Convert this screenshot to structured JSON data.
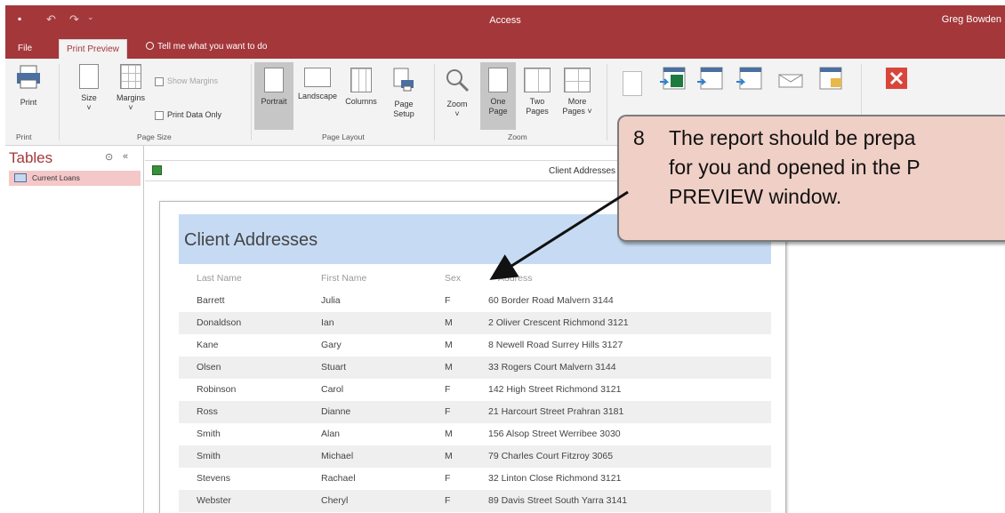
{
  "window": {
    "app_title": "Access",
    "user": "Greg Bowden"
  },
  "tabs": {
    "file": "File",
    "print_preview": "Print Preview",
    "tell_me": "Tell me what you want to do"
  },
  "ribbon": {
    "print": "Print",
    "size": "Size",
    "margins": "Margins",
    "show_margins": "Show Margins",
    "print_data_only": "Print Data Only",
    "portrait": "Portrait",
    "landscape": "Landscape",
    "columns": "Columns",
    "page_setup_1": "Page",
    "page_setup_2": "Setup",
    "zoom": "Zoom",
    "one_page_1": "One",
    "one_page_2": "Page",
    "two_pages_1": "Two",
    "two_pages_2": "Pages",
    "more_pages_1": "More",
    "more_pages_2": "Pages ˅",
    "groups": {
      "print": "Print",
      "page_size": "Page Size",
      "page_layout": "Page Layout",
      "zoom": "Zoom"
    }
  },
  "nav": {
    "title": "Tables",
    "item": "Current Loans"
  },
  "document": {
    "tab_label": "Client Addresses"
  },
  "report": {
    "title": "Client Addresses",
    "headers": {
      "last": "Last Name",
      "first": "First Name",
      "sex": "Sex",
      "address": "Address"
    },
    "rows": [
      {
        "last": "Barrett",
        "first": "Julia",
        "sex": "F",
        "address": "60 Border Road Malvern 3144"
      },
      {
        "last": "Donaldson",
        "first": "Ian",
        "sex": "M",
        "address": "2 Oliver Crescent Richmond 3121"
      },
      {
        "last": "Kane",
        "first": "Gary",
        "sex": "M",
        "address": "8 Newell Road Surrey Hills 3127"
      },
      {
        "last": "Olsen",
        "first": "Stuart",
        "sex": "M",
        "address": "33 Rogers Court Malvern 3144"
      },
      {
        "last": "Robinson",
        "first": "Carol",
        "sex": "F",
        "address": "142 High Street Richmond 3121"
      },
      {
        "last": "Ross",
        "first": "Dianne",
        "sex": "F",
        "address": "21 Harcourt Street Prahran 3181"
      },
      {
        "last": "Smith",
        "first": "Alan",
        "sex": "M",
        "address": "156 Alsop Street Werribee 3030"
      },
      {
        "last": "Smith",
        "first": "Michael",
        "sex": "M",
        "address": "79 Charles Court Fitzroy 3065"
      },
      {
        "last": "Stevens",
        "first": "Rachael",
        "sex": "F",
        "address": "32 Linton Close Richmond 3121"
      },
      {
        "last": "Webster",
        "first": "Cheryl",
        "sex": "F",
        "address": "89 Davis Street South Yarra 3141"
      }
    ]
  },
  "callout": {
    "number": "8",
    "line1": "The report should be prepa",
    "line2": "for you and opened in the P",
    "line3": "PREVIEW window."
  },
  "colors": {
    "brand": "#a4373a",
    "callout_bg": "#efcfc6",
    "report_header": "#c6dbf3"
  }
}
